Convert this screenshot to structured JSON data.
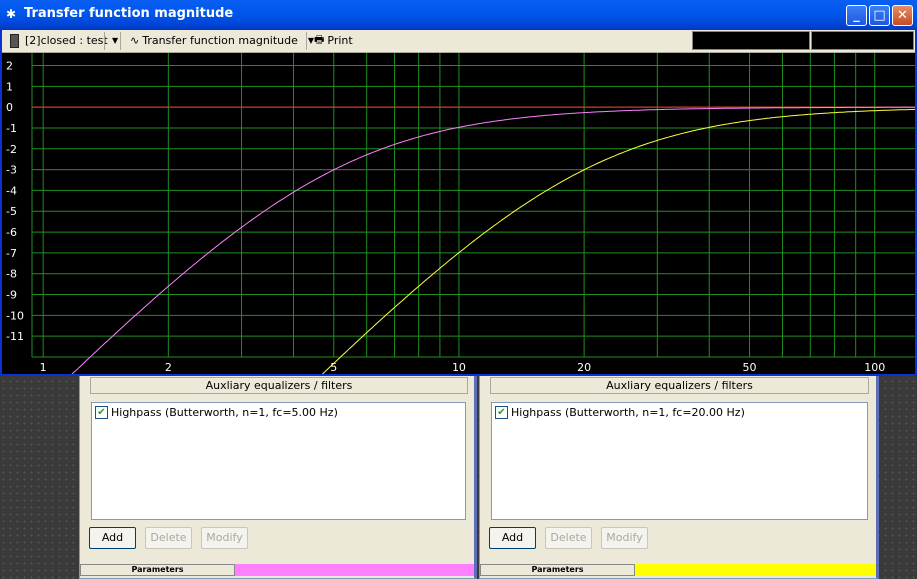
{
  "window": {
    "title": "Transfer function magnitude",
    "buttons": {
      "minimize": "_",
      "maximize": "□",
      "close": "✕"
    }
  },
  "toolbar": {
    "source_label": "[2]closed : test",
    "view_label": "Transfer function magnitude",
    "print_label": "Print"
  },
  "panels": [
    {
      "section_title": "Auxliary equalizers / filters",
      "filter_label": "Highpass (Butterworth, n=1, fc=5.00 Hz)",
      "checked": true,
      "buttons": {
        "add": "Add",
        "delete": "Delete",
        "modify": "Modify"
      },
      "params_label": "Parameters",
      "color": "#ff80ff"
    },
    {
      "section_title": "Auxliary equalizers / filters",
      "filter_label": "Highpass (Butterworth, n=1, fc=20.00 Hz)",
      "checked": true,
      "buttons": {
        "add": "Add",
        "delete": "Delete",
        "modify": "Modify"
      },
      "params_label": "Parameters",
      "color": "#ffff00"
    }
  ],
  "chart_data": {
    "type": "line",
    "x_scale": "log",
    "grid": true,
    "xlim": [
      0.94,
      125
    ],
    "ylim": [
      -12,
      2.6
    ],
    "x_ticks": [
      1,
      2,
      5,
      10,
      20,
      50,
      100
    ],
    "y_ticks": [
      2,
      1,
      0,
      -1,
      -2,
      -3,
      -4,
      -5,
      -6,
      -7,
      -8,
      -9,
      -10,
      -11
    ],
    "reference_lines": [
      {
        "y": 0,
        "color": "#ff3030"
      },
      {
        "y": -3,
        "color": "#a020a0"
      }
    ],
    "series": [
      {
        "fc": 5,
        "order": 1,
        "color": "#ff80ff"
      },
      {
        "fc": 20,
        "order": 1,
        "color": "#ffff40"
      }
    ]
  }
}
